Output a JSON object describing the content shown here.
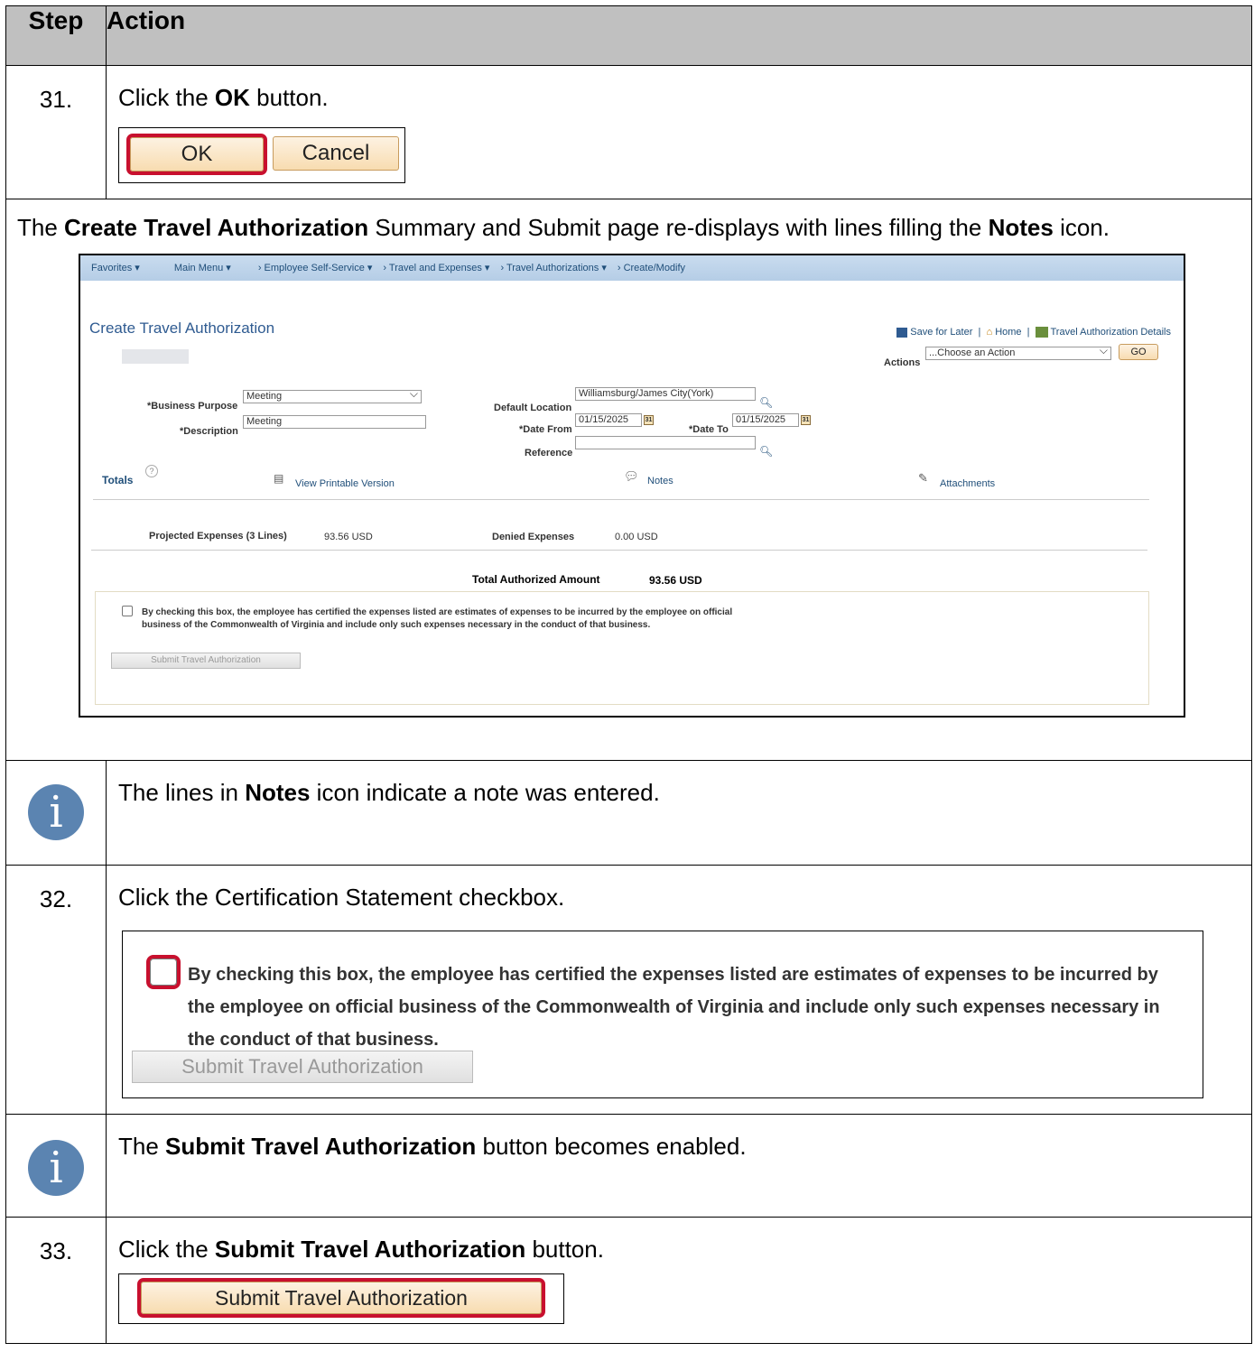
{
  "header": {
    "step": "Step",
    "action": "Action"
  },
  "step31": {
    "number": "31.",
    "pre": "Click the ",
    "bold": "OK",
    "post": " button.",
    "ok_label": "OK",
    "cancel_label": "Cancel"
  },
  "redisplay": {
    "pre": "The ",
    "bold1": "Create Travel Authorization",
    "mid": " Summary and Submit page re-displays with lines filling the ",
    "bold2": "Notes",
    "post": " icon."
  },
  "ps": {
    "nav": [
      "Favorites ▾",
      "Main Menu ▾",
      "›  Employee Self-Service ▾",
      "›  Travel and Expenses ▾",
      "›  Travel Authorizations ▾",
      "›  Create/Modify"
    ],
    "title": "Create Travel Authorization",
    "save_later": "Save for Later",
    "home": "Home",
    "ta_details": "Travel Authorization Details",
    "actions_label": "Actions",
    "actions_value": "...Choose an Action",
    "go": "GO",
    "business_purpose_label": "*Business Purpose",
    "business_purpose_value": "Meeting",
    "description_label": "*Description",
    "description_value": "Meeting",
    "default_location_label": "Default Location",
    "default_location_value": "Williamsburg/James City(York)",
    "date_from_label": "*Date From",
    "date_from_value": "01/15/2025",
    "date_to_label": "*Date To",
    "date_to_value": "01/15/2025",
    "reference_label": "Reference",
    "totals": "Totals",
    "printable": "View Printable Version",
    "notes": "Notes",
    "attachments": "Attachments",
    "projected_label": "Projected Expenses (3 Lines)",
    "projected_value": "93.56  USD",
    "denied_label": "Denied Expenses",
    "denied_value": "0.00  USD",
    "total_label": "Total Authorized Amount",
    "total_value": "93.56  USD",
    "cert_text": "By checking this box, the employee has certified the expenses listed are estimates of expenses to be incurred by the employee on official business of the Commonwealth of Virginia and include only such expenses necessary in the conduct of that business.",
    "submit_label": "Submit Travel Authorization"
  },
  "info1": {
    "pre": "The lines in ",
    "bold": "Notes",
    "post": " icon indicate a note was entered."
  },
  "step32": {
    "number": "32.",
    "text": "Click the Certification Statement checkbox.",
    "cert_line1": "By checking this box, the employee has certified the expenses listed are estimates of expenses to be incurred by",
    "cert_line2": "the employee on official business of the Commonwealth of Virginia and include only such expenses necessary in",
    "cert_line3": "the conduct of that business.",
    "submit_label": "Submit Travel Authorization"
  },
  "info2": {
    "pre": "The ",
    "bold": "Submit Travel Authorization",
    "post": " button becomes enabled."
  },
  "step33": {
    "number": "33.",
    "pre": "Click the ",
    "bold": "Submit Travel Authorization",
    "post": " button.",
    "submit_label": "Submit Travel Authorization"
  },
  "icons": {
    "info": "info-icon",
    "calendar": "calendar-icon",
    "lookup": "magnifier-icon",
    "help": "help-icon",
    "notes": "notes-icon",
    "printer": "printer-icon",
    "attachment": "attachment-icon",
    "save": "save-icon",
    "home": "home-icon"
  },
  "colors": {
    "header_bg": "#c0c0c0",
    "highlight": "#c8102e",
    "info_icon": "#5b84b1",
    "nav_bg": "#c9dcef",
    "button_bg": "#f8dcb0"
  }
}
